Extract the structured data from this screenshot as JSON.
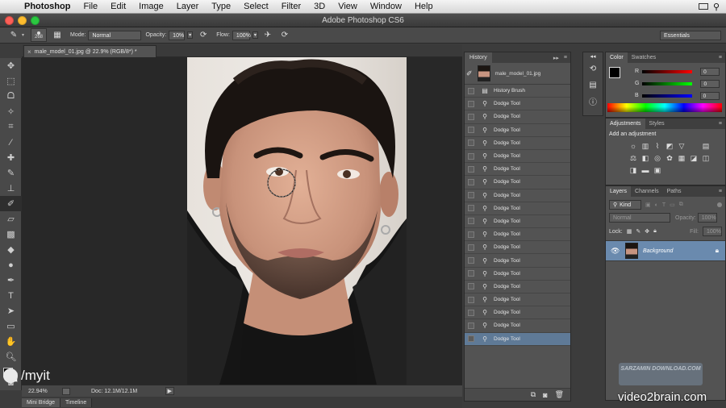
{
  "menubar": {
    "app_name": "Photoshop",
    "items": [
      "File",
      "Edit",
      "Image",
      "Layer",
      "Type",
      "Select",
      "Filter",
      "3D",
      "View",
      "Window",
      "Help"
    ]
  },
  "window": {
    "title": "Adobe Photoshop CS6"
  },
  "options": {
    "brush_size": "268",
    "mode_label": "Mode:",
    "mode_value": "Normal",
    "opacity_label": "Opacity:",
    "opacity_value": "10%",
    "flow_label": "Flow:",
    "flow_value": "100%",
    "workspace": "Essentials"
  },
  "document": {
    "tab_title": "male_model_01.jpg @ 22.9% (RGB/8*) *",
    "tab_close": "×"
  },
  "status": {
    "zoom": "22.94%",
    "doc": "Doc: 12.1M/12.1M"
  },
  "bottom_tabs": [
    "Mini Bridge",
    "Timeline"
  ],
  "history": {
    "tab": "History",
    "snapshot": "male_model_01.jpg",
    "items": [
      "History Brush",
      "Dodge Tool",
      "Dodge Tool",
      "Dodge Tool",
      "Dodge Tool",
      "Dodge Tool",
      "Dodge Tool",
      "Dodge Tool",
      "Dodge Tool",
      "Dodge Tool",
      "Dodge Tool",
      "Dodge Tool",
      "Dodge Tool",
      "Dodge Tool",
      "Dodge Tool",
      "Dodge Tool",
      "Dodge Tool",
      "Dodge Tool",
      "Dodge Tool",
      "Dodge Tool"
    ]
  },
  "color_panel": {
    "tabs": [
      "Color",
      "Swatches"
    ],
    "r_label": "R",
    "g_label": "G",
    "b_label": "B",
    "r_value": "0",
    "g_value": "0",
    "b_value": "0"
  },
  "adjustments_panel": {
    "tabs": [
      "Adjustments",
      "Styles"
    ],
    "heading": "Add an adjustment"
  },
  "layers_panel": {
    "tabs": [
      "Layers",
      "Channels",
      "Paths"
    ],
    "kind": "Kind",
    "blend_mode": "Normal",
    "opacity_label": "Opacity:",
    "opacity_value": "100%",
    "lock_label": "Lock:",
    "fill_label": "Fill:",
    "fill_value": "100%",
    "layer_name": "Background"
  },
  "watermarks": {
    "left": "/myit",
    "right": "video2brain.com",
    "logo": "SARZAMIN DOWNLOAD.COM"
  },
  "colors": {
    "selected_row": "#5f7a97",
    "layer_selected": "#6a8aae"
  }
}
